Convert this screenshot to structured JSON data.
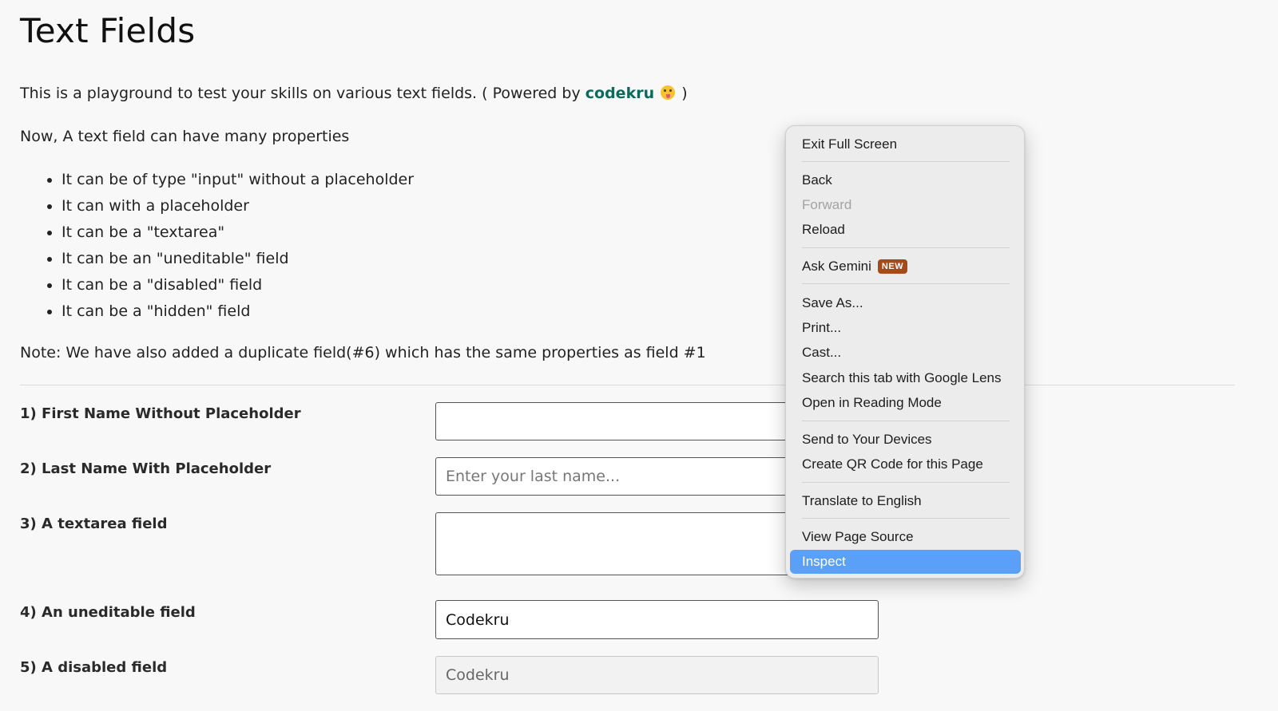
{
  "page": {
    "title": "Text Fields",
    "intro_prefix": "This is a playground to test your skills on various text fields. ( Powered by",
    "intro_brand": "codekru",
    "intro_suffix": ")",
    "lead": "Now, A text field can have many properties",
    "properties": [
      "It can be of type \"input\" without a placeholder",
      "It can with a placeholder",
      "It can be a \"textarea\"",
      "It can be an \"uneditable\" field",
      "It can be a \"disabled\" field",
      "It can be a \"hidden\" field"
    ],
    "note": "Note: We have also added a duplicate field(#6) which has the same properties as field #1"
  },
  "fields": {
    "first_name": {
      "label": "1) First Name Without Placeholder",
      "value": ""
    },
    "last_name": {
      "label": "2) Last Name With Placeholder",
      "placeholder": "Enter your last name..."
    },
    "textarea": {
      "label": "3) A textarea field",
      "value": ""
    },
    "uneditable": {
      "label": "4) An uneditable field",
      "value": "Codekru"
    },
    "disabled": {
      "label": "5) A disabled field",
      "value": "Codekru"
    }
  },
  "context_menu": {
    "exit_full_screen": "Exit Full Screen",
    "back": "Back",
    "forward": "Forward",
    "reload": "Reload",
    "ask_gemini": "Ask Gemini",
    "ask_gemini_badge": "NEW",
    "save_as": "Save As...",
    "print": "Print...",
    "cast": "Cast...",
    "google_lens": "Search this tab with Google Lens",
    "reading_mode": "Open in Reading Mode",
    "send_devices": "Send to Your Devices",
    "qr_code": "Create QR Code for this Page",
    "translate": "Translate to English",
    "view_source": "View Page Source",
    "inspect": "Inspect"
  },
  "colors": {
    "brand": "#0a6b5c",
    "highlight": "#5aa0f8",
    "badge": "#a64b17"
  }
}
